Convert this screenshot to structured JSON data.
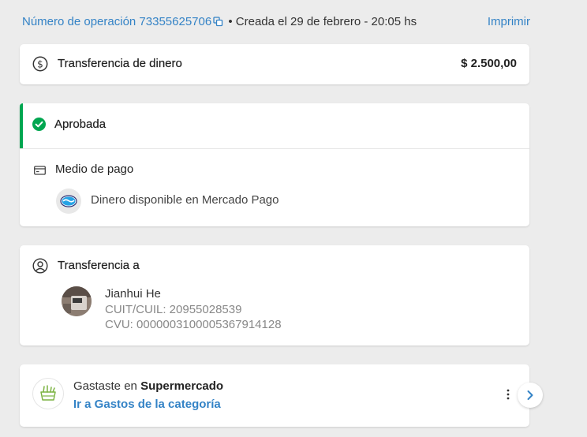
{
  "header": {
    "operation_link": "Número de operación 73355625706",
    "created": "• Creada el 29 de febrero - 20:05 hs",
    "print_label": "Imprimir"
  },
  "summary": {
    "title": "Transferencia de dinero",
    "amount": "$ 2.500,00"
  },
  "status": {
    "label": "Aprobada",
    "color": "#00a650"
  },
  "payment": {
    "title": "Medio de pago",
    "method": "Dinero disponible en Mercado Pago"
  },
  "recipient": {
    "title": "Transferencia a",
    "name": "Jianhui He",
    "cuit": "CUIT/CUIL: 20955028539",
    "cvu": "CVU: 0000003100005367914128"
  },
  "category": {
    "spent_prefix": "Gastaste en ",
    "category_name": "Supermercado",
    "link_label": "Ir a Gastos de la categoría"
  },
  "icons": {
    "copy": "copy-icon",
    "dollar": "dollar-circle-icon",
    "check": "check-circle-icon",
    "card": "credit-card-icon",
    "mercadopago": "mercadopago-logo-icon",
    "user": "user-circle-icon",
    "basket": "grocery-basket-icon",
    "more": "more-vertical-icon",
    "next": "chevron-right-icon"
  },
  "colors": {
    "accent": "#3483c6",
    "success": "#00a650",
    "background": "#ececec"
  }
}
